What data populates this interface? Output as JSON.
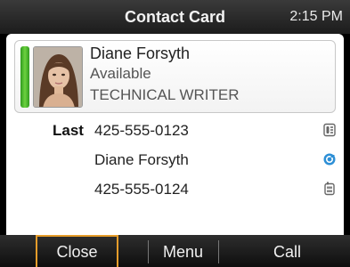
{
  "statusbar": {
    "title": "Contact Card",
    "time": "2:15 PM"
  },
  "contact": {
    "name": "Diane Forsyth",
    "presence": "Available",
    "title": "TECHNICAL WRITER",
    "presence_color": "#4fbf2c"
  },
  "details": [
    {
      "label": "Last",
      "value": "425-555-0123",
      "icon": "work-phone-icon"
    },
    {
      "label": "",
      "value": "Diane Forsyth",
      "icon": "im-icon"
    },
    {
      "label": "",
      "value": "425-555-0124",
      "icon": "mobile-phone-icon"
    }
  ],
  "softkeys": {
    "close": "Close",
    "menu": "Menu",
    "call": "Call"
  }
}
